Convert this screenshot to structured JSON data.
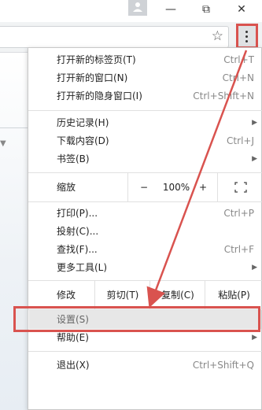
{
  "browser": {
    "window_buttons": {
      "minimize": "—",
      "maximize": "⧉",
      "close": "✕"
    },
    "icons": {
      "profile": "profile-icon",
      "star": "star-icon",
      "menu": "kebab-menu-icon"
    }
  },
  "menu": {
    "group1": [
      {
        "label": "打开新的标签页(T)",
        "shortcut": "Ctrl+T"
      },
      {
        "label": "打开新的窗口(N)",
        "shortcut": "Ctrl+N"
      },
      {
        "label": "打开新的隐身窗口(I)",
        "shortcut": "Ctrl+Shift+N"
      }
    ],
    "group2": [
      {
        "label": "历史记录(H)",
        "shortcut": "",
        "submenu": "▶"
      },
      {
        "label": "下载内容(D)",
        "shortcut": "Ctrl+J"
      },
      {
        "label": "书签(B)",
        "shortcut": "",
        "submenu": "▶"
      }
    ],
    "zoom": {
      "label": "缩放",
      "minus": "−",
      "value": "100%",
      "plus": "+",
      "fullscreen": "⛶"
    },
    "group3": [
      {
        "label": "打印(P)...",
        "shortcut": "Ctrl+P"
      },
      {
        "label": "投射(C)...",
        "shortcut": ""
      },
      {
        "label": "查找(F)...",
        "shortcut": "Ctrl+F"
      },
      {
        "label": "更多工具(L)",
        "shortcut": "",
        "submenu": "▶"
      }
    ],
    "edit": {
      "label": "修改",
      "cut": "剪切(T)",
      "copy": "复制(C)",
      "paste": "粘贴(P)"
    },
    "group4": [
      {
        "label": "设置(S)",
        "shortcut": ""
      },
      {
        "label": "帮助(E)",
        "shortcut": "",
        "submenu": "▶"
      }
    ],
    "exit": {
      "label": "退出(X)",
      "shortcut": "Ctrl+Shift+Q"
    }
  },
  "annotation": {
    "color": "#d9534f"
  }
}
